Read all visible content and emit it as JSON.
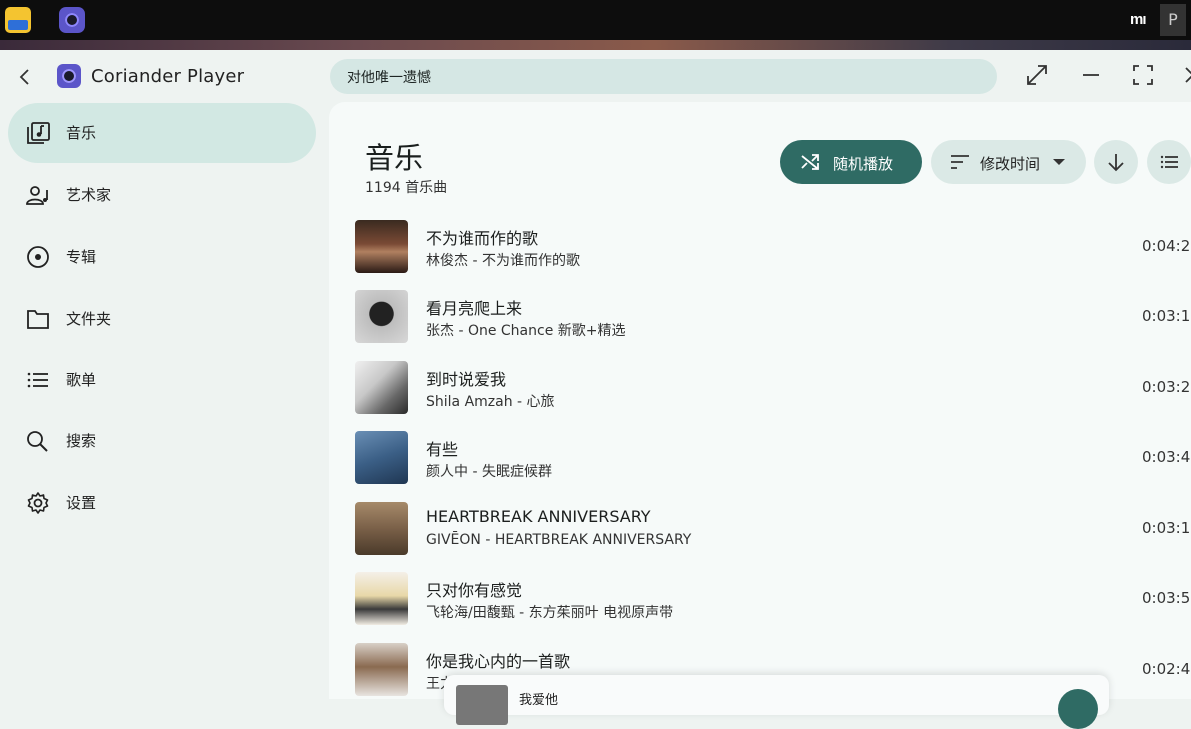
{
  "window": {
    "app_title": "Coriander Player",
    "search_text": "对他唯一遗憾"
  },
  "os": {
    "mi_label": "mı",
    "p_label": "P"
  },
  "sidebar": {
    "items": [
      {
        "label": "音乐",
        "icon": "music-library-icon"
      },
      {
        "label": "艺术家",
        "icon": "artist-icon"
      },
      {
        "label": "专辑",
        "icon": "album-icon"
      },
      {
        "label": "文件夹",
        "icon": "folder-icon"
      },
      {
        "label": "歌单",
        "icon": "playlist-icon"
      },
      {
        "label": "搜索",
        "icon": "search-icon"
      },
      {
        "label": "设置",
        "icon": "gear-icon"
      }
    ]
  },
  "main": {
    "title": "音乐",
    "count": "1194 首乐曲",
    "shuffle_label": "随机播放",
    "sort_label": "修改时间"
  },
  "songs": [
    {
      "title": "不为谁而作的歌",
      "sub": "林俊杰 - 不为谁而作的歌",
      "duration": "0:04:2"
    },
    {
      "title": "看月亮爬上来",
      "sub": "张杰 - One Chance 新歌+精选",
      "duration": "0:03:1"
    },
    {
      "title": "到时说爱我",
      "sub": "Shila Amzah - 心旅",
      "duration": "0:03:2"
    },
    {
      "title": "有些",
      "sub": "颜人中 - 失眠症候群",
      "duration": "0:03:4"
    },
    {
      "title": "HEARTBREAK ANNIVERSARY",
      "sub": "GIVĒON - HEARTBREAK ANNIVERSARY",
      "duration": "0:03:1"
    },
    {
      "title": "只对你有感觉",
      "sub": "飞轮海/田馥甄 - 东方茱丽叶 电视原声带",
      "duration": "0:03:5"
    },
    {
      "title": "你是我心内的一首歌",
      "sub": "王力宏",
      "duration": "0:02:4"
    }
  ],
  "mini_player": {
    "title": "我爱他"
  },
  "colors": {
    "accent": "#2f6b64",
    "nav_active": "#d2e8e3",
    "search_bg": "#d5e7e4"
  }
}
